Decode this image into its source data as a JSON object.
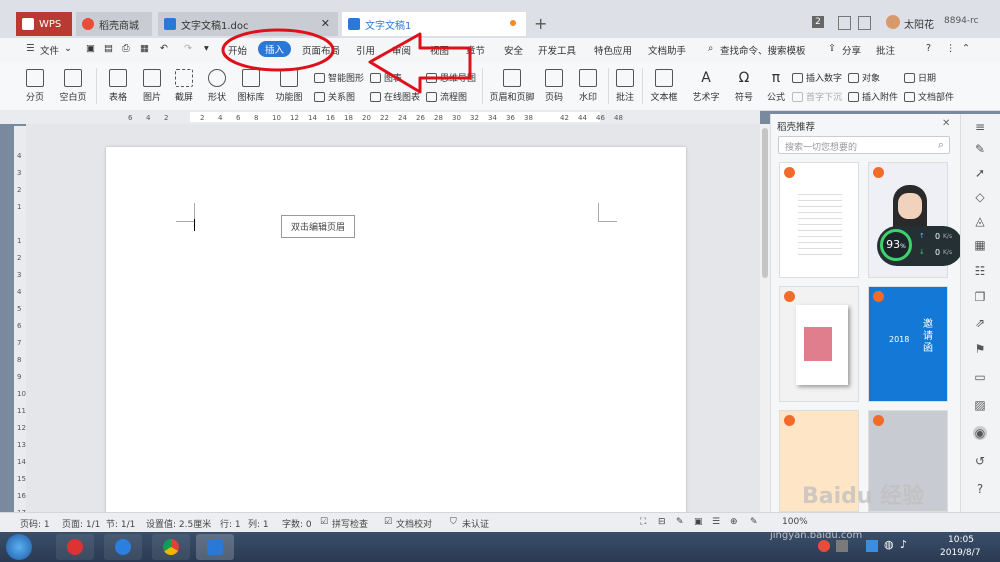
{
  "tabbar": {
    "tabs": [
      {
        "label": "WPS",
        "color": "#c9302c"
      },
      {
        "label": "稻壳商城",
        "color": "#e94b3c"
      },
      {
        "label": "文字文稿1.doc",
        "color": "#2b79d6"
      },
      {
        "label": "文字文稿1",
        "color": "#2b79d6"
      }
    ],
    "new_tab": "+",
    "badge": "2",
    "user": "太阳花",
    "code": "8894-rc"
  },
  "menu": {
    "file": "文件",
    "items": [
      "开始",
      "插入",
      "页面布局",
      "引用",
      "审阅",
      "视图",
      "章节",
      "安全",
      "开发工具",
      "特色应用",
      "文档助手"
    ],
    "active": "插入",
    "search": "查找命令、搜索模板",
    "share": "分享",
    "comment": "批注"
  },
  "ribbon": {
    "groups": [
      {
        "label": "分页"
      },
      {
        "label": "空白页"
      },
      {
        "label": "表格"
      },
      {
        "label": "图片"
      },
      {
        "label": "截屏"
      },
      {
        "label": "形状"
      },
      {
        "label": "图标库"
      },
      {
        "label": "功能图"
      },
      {
        "label": "页眉和页脚"
      },
      {
        "label": "页码"
      },
      {
        "label": "水印"
      },
      {
        "label": "批注"
      },
      {
        "label": "文本框"
      },
      {
        "label": "艺术字"
      },
      {
        "label": "符号"
      },
      {
        "label": "公式"
      }
    ],
    "small": [
      "智能图形",
      "关系图",
      "图表",
      "在线图表",
      "思维导图",
      "流程图",
      "插入数字",
      "首字下沉",
      "对象",
      "插入附件",
      "日期",
      "文档部件"
    ]
  },
  "ruler": {
    "h_ticks": [
      "6",
      "4",
      "2",
      "",
      "2",
      "4",
      "6",
      "8",
      "10",
      "12",
      "14",
      "16",
      "18",
      "20",
      "22",
      "24",
      "26",
      "28",
      "30",
      "32",
      "34",
      "36",
      "38",
      "",
      "42",
      "44",
      "46",
      "48"
    ],
    "v_ticks": [
      "4",
      "3",
      "2",
      "1",
      "",
      "1",
      "2",
      "3",
      "4",
      "5",
      "6",
      "7",
      "8",
      "9",
      "10",
      "11",
      "12",
      "13",
      "14",
      "15",
      "16",
      "17",
      "18"
    ]
  },
  "document": {
    "header_hint": "双击编辑页眉"
  },
  "sidepanel": {
    "title": "稻壳推荐",
    "search_placeholder": "搜索一切您想要的",
    "widget_percent": "93",
    "widget_unit": "%",
    "speed_up": "0",
    "speed_down": "0",
    "speed_unit": "K/s",
    "invite_text": "邀请函",
    "invite_year": "2018"
  },
  "statusbar": {
    "page": "页码: 1",
    "pages": "页面: 1/1",
    "section": "节: 1/1",
    "setting": "设置值: 2.5厘米",
    "row": "行: 1",
    "col": "列: 1",
    "words": "字数: 0",
    "spell": "拼写检查",
    "proof": "文档校对",
    "cert": "未认证",
    "zoom": "100%"
  },
  "taskbar": {
    "time": "10:05",
    "date": "2019/8/7"
  },
  "watermark": {
    "text": "Baidu 经验",
    "sub": "jingyan.baidu.com"
  },
  "colors": {
    "accent": "#2b79d6",
    "annotation_red": "#e0101a"
  }
}
